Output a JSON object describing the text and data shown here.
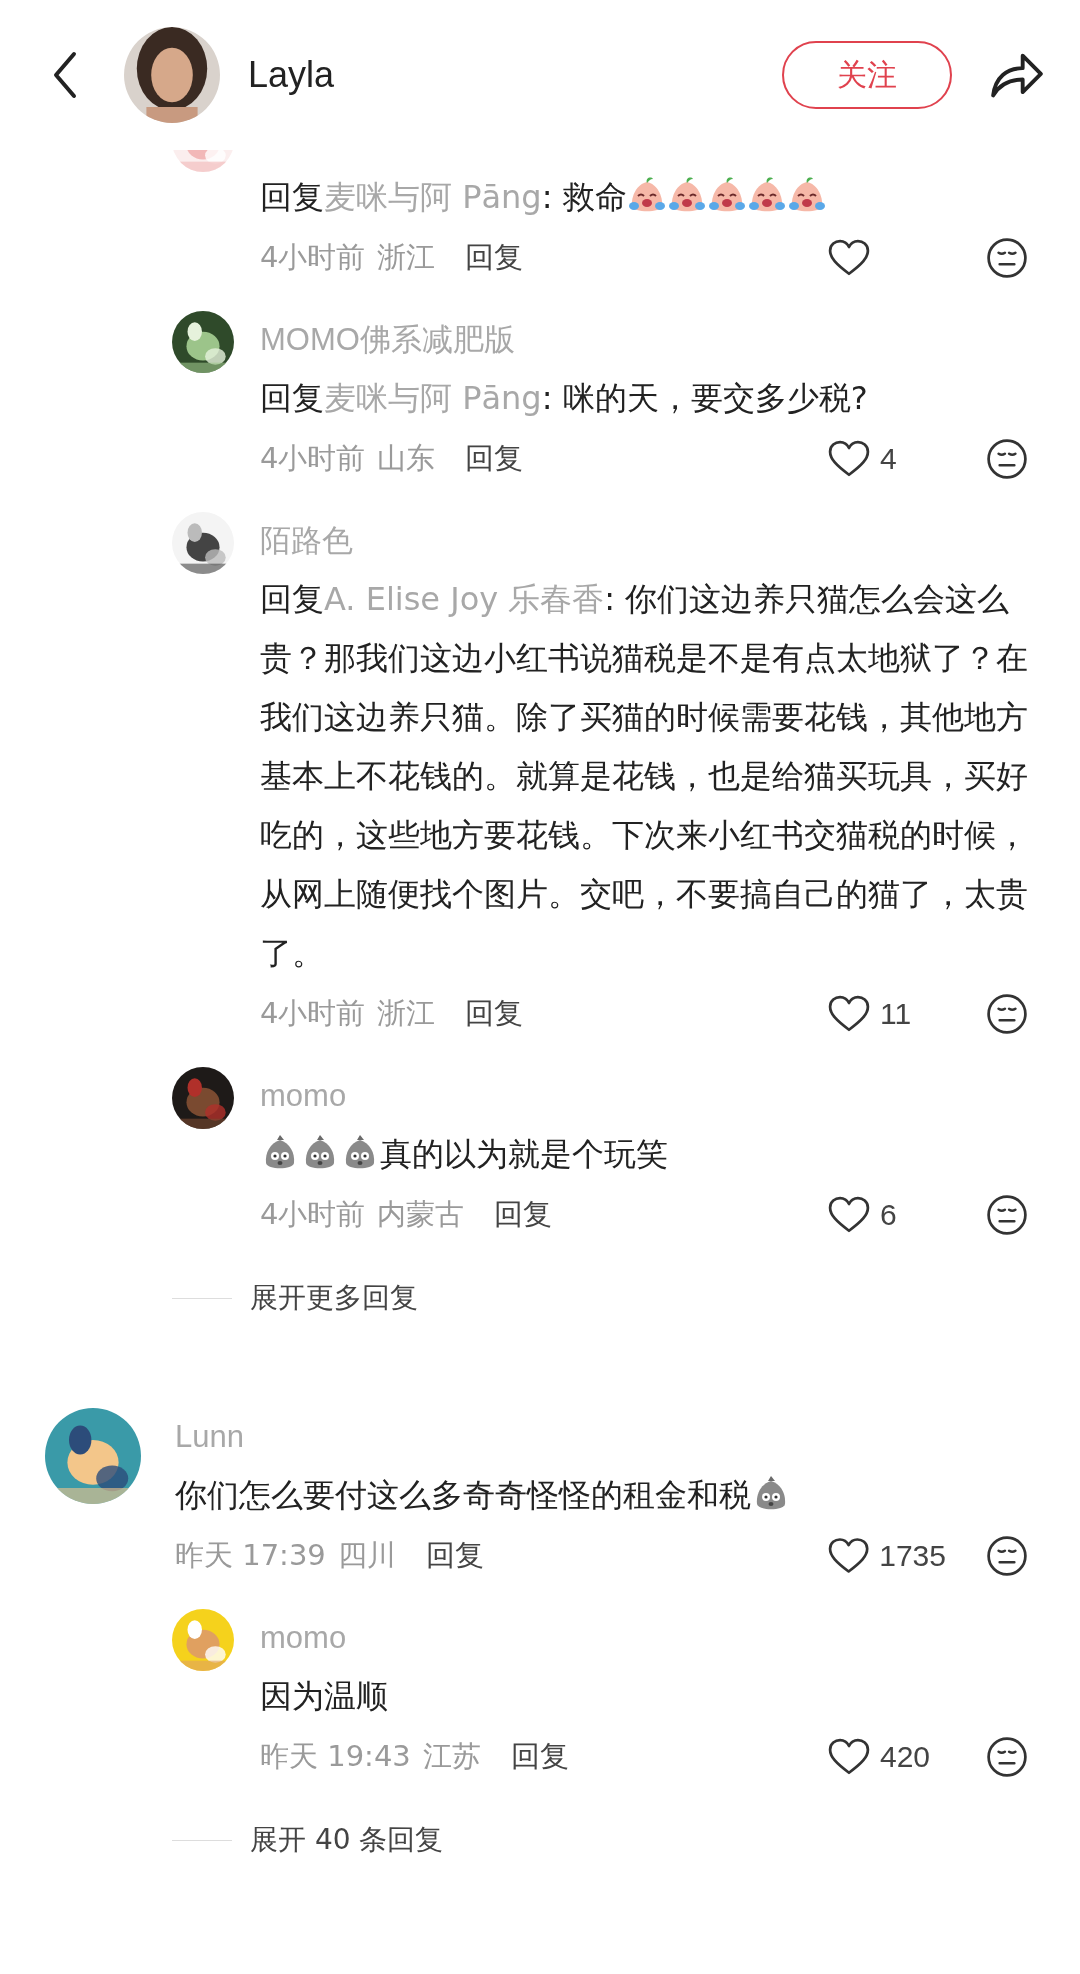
{
  "header": {
    "user_name": "Layla",
    "follow_label": "关注"
  },
  "threads": [
    {
      "replies": [
        {
          "reply_prefix": "回复",
          "reply_to": "麦咪与阿 Pāng",
          "text": ": 救命",
          "emojis_after": [
            {
              "kind": "crying"
            },
            {
              "kind": "crying"
            },
            {
              "kind": "crying"
            },
            {
              "kind": "crying"
            },
            {
              "kind": "crying"
            }
          ],
          "time": "4小时前",
          "location": "浙江",
          "reply_label": "回复"
        },
        {
          "name": "MOMO佛系减肥版",
          "reply_prefix": "回复",
          "reply_to": "麦咪与阿 Pāng",
          "text": ": 咪的天，要交多少税?",
          "time": "4小时前",
          "location": "山东",
          "reply_label": "回复",
          "likes": "4"
        },
        {
          "name": "陌路色",
          "reply_prefix": "回复",
          "reply_to": "A. Elise Joy 乐春香",
          "text": ": 你们这边养只猫怎么会这么贵？那我们这边小红书说猫税是不是有点太地狱了？在我们这边养只猫。除了买猫的时候需要花钱，其他地方基本上不花钱的。就算是花钱，也是给猫买玩具，买好吃的，这些地方要花钱。下次来小红书交猫税的时候，从网上随便找个图片。交吧，不要搞自己的猫了，太贵了。",
          "time": "4小时前",
          "location": "浙江",
          "reply_label": "回复",
          "likes": "11"
        },
        {
          "name": "momo",
          "text": "真的以为就是个玩笑",
          "emojis_before": [
            {
              "kind": "bag"
            },
            {
              "kind": "bag"
            },
            {
              "kind": "bag"
            }
          ],
          "time": "4小时前",
          "location": "内蒙古",
          "reply_label": "回复",
          "likes": "6"
        }
      ],
      "expand_label": "展开更多回复"
    },
    {
      "comment": {
        "name": "Lunn",
        "text": "你们怎么要付这么多奇奇怪怪的租金和税",
        "emojis_after": [
          {
            "kind": "bag"
          }
        ],
        "time": "昨天 17:39",
        "location": "四川",
        "reply_label": "回复",
        "likes": "1735"
      },
      "replies": [
        {
          "name": "momo",
          "text": "因为温顺",
          "time": "昨天 19:43",
          "location": "江苏",
          "reply_label": "回复",
          "likes": "420"
        }
      ],
      "expand_label": "展开 40 条回复"
    }
  ]
}
